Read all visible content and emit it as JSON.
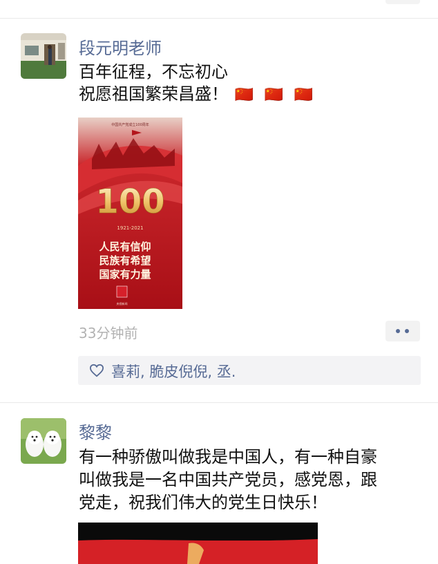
{
  "post1": {
    "author": "段元明老师",
    "line1": "百年征程，不忘初心",
    "line2": "祝愿祖国繁荣昌盛！",
    "emoji": [
      "🇨🇳",
      "🇨🇳",
      "🇨🇳"
    ],
    "image": {
      "top_caption": "中国共产党成立100周年",
      "big_number": "100",
      "years": "1921-2021",
      "slogans": [
        "人民有信仰",
        "民族有希望",
        "国家有力量"
      ],
      "stamp": "央视\n新闻",
      "watermark": "央视新闻"
    },
    "time": "33分钟前",
    "likes": [
      "喜莉",
      "脆皮倪倪",
      "丞."
    ],
    "like_separator": ", "
  },
  "post2": {
    "author": "黎黎",
    "text_lines": [
      "有一种骄傲叫做我是中国人，有一种自豪",
      "叫做我是一名中国共产党员，感党恩，跟",
      "党走，祝我们伟大的党生日快乐！"
    ]
  },
  "colors": {
    "link_blue": "#576b95",
    "time_gray": "#b2b2b2",
    "poster_red": "#b4131a",
    "poster_gold": "#f0c36a"
  }
}
